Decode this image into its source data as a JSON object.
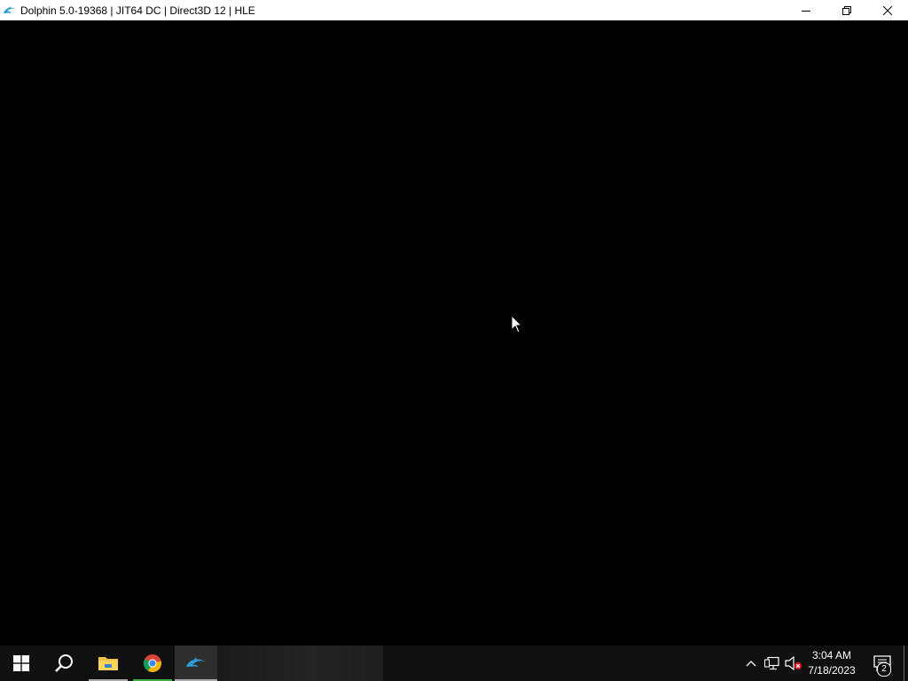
{
  "window": {
    "title": "Dolphin 5.0-19368 | JIT64 DC | Direct3D 12 | HLE",
    "app_icon": "dolphin-icon",
    "caption_buttons": [
      "minimize-icon",
      "restore-icon",
      "close-icon"
    ]
  },
  "render_area": {
    "background": "#000000"
  },
  "taskbar": {
    "background": "#101010",
    "pinned": [
      {
        "name": "Start",
        "icon": "windows-logo-icon"
      },
      {
        "name": "Search",
        "icon": "search-icon"
      },
      {
        "name": "File Explorer",
        "icon": "folder-icon"
      },
      {
        "name": "Google Chrome",
        "icon": "chrome-icon"
      },
      {
        "name": "Dolphin",
        "icon": "dolphin-icon"
      }
    ],
    "tray": {
      "icons": [
        "chevron-up-icon",
        "network-icon",
        "volume-muted-icon"
      ],
      "time": "3:04 AM",
      "date": "7/18/2023",
      "notification_count": "2"
    }
  },
  "colors": {
    "chrome_green": "#3fae49",
    "dolphin_blue": "#2d9bd6",
    "folder_yellow": "#f6c244",
    "muted_red": "#e81123"
  }
}
